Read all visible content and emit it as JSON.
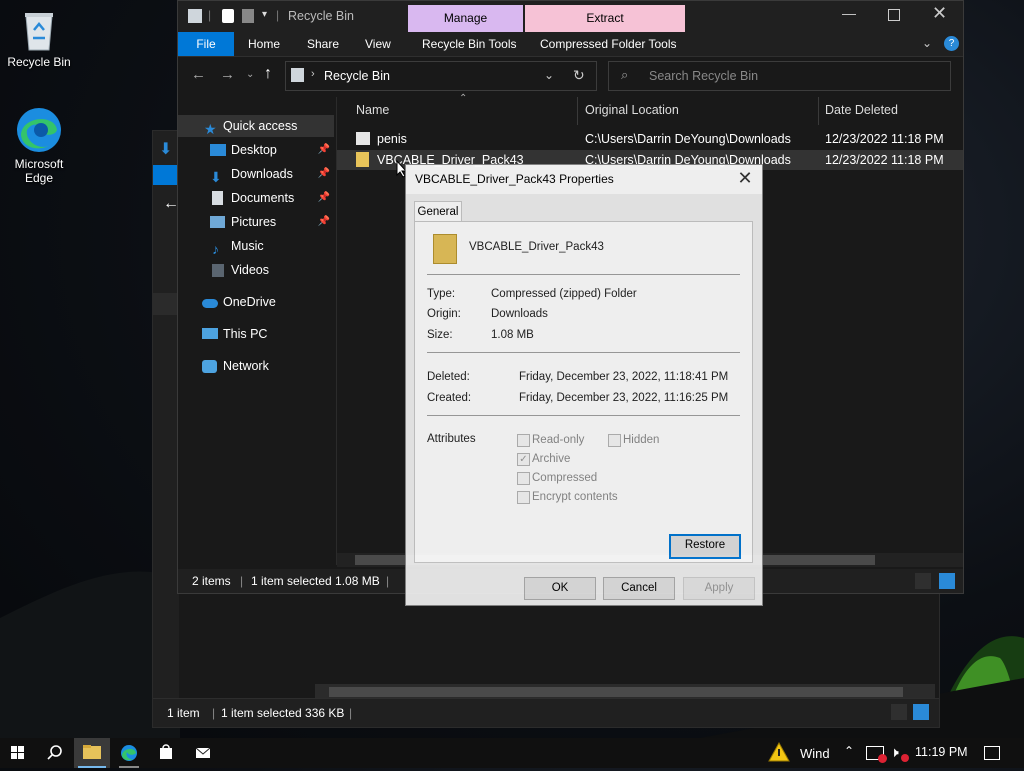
{
  "desktop": {
    "icons": [
      {
        "label": "Recycle Bin"
      },
      {
        "label": "Microsoft Edge"
      }
    ]
  },
  "back_window": {
    "status": {
      "count": "1 item",
      "selected": "1 item selected  336 KB"
    }
  },
  "window": {
    "title": "Recycle Bin",
    "context_tabs": {
      "manage": "Manage",
      "extract": "Extract"
    },
    "ribbon_tabs": [
      "File",
      "Home",
      "Share",
      "View",
      "Recycle Bin Tools",
      "Compressed Folder Tools"
    ],
    "address": {
      "location": "Recycle Bin"
    },
    "search": {
      "placeholder": "Search Recycle Bin"
    },
    "nav": {
      "quick_access": "Quick access",
      "desktop": "Desktop",
      "downloads": "Downloads",
      "documents": "Documents",
      "pictures": "Pictures",
      "music": "Music",
      "videos": "Videos",
      "onedrive": "OneDrive",
      "this_pc": "This PC",
      "network": "Network"
    },
    "columns": {
      "name": "Name",
      "original_location": "Original Location",
      "date_deleted": "Date Deleted"
    },
    "files": [
      {
        "name": "penis",
        "location": "C:\\Users\\Darrin DeYoung\\Downloads",
        "date": "12/23/2022 11:18 PM"
      },
      {
        "name": "VBCABLE_Driver_Pack43",
        "location": "C:\\Users\\Darrin DeYoung\\Downloads",
        "date": "12/23/2022 11:18 PM"
      }
    ],
    "status": {
      "count": "2 items",
      "selected": "1 item selected  1.08 MB"
    }
  },
  "dialog": {
    "title": "VBCABLE_Driver_Pack43 Properties",
    "tab": "General",
    "file_name": "VBCABLE_Driver_Pack43",
    "type_label": "Type:",
    "type_value": "Compressed (zipped) Folder",
    "origin_label": "Origin:",
    "origin_value": "Downloads",
    "size_label": "Size:",
    "size_value": "1.08 MB",
    "deleted_label": "Deleted:",
    "deleted_value": "Friday, December 23, 2022, 11:18:41 PM",
    "created_label": "Created:",
    "created_value": "Friday, December 23, 2022, 11:16:25 PM",
    "attributes_label": "Attributes",
    "attributes": {
      "read_only": {
        "label": "Read-only",
        "checked": false
      },
      "hidden": {
        "label": "Hidden",
        "checked": false
      },
      "archive": {
        "label": "Archive",
        "checked": true
      },
      "compressed": {
        "label": "Compressed",
        "checked": false
      },
      "encrypt": {
        "label": "Encrypt contents",
        "checked": false
      }
    },
    "restore": "Restore",
    "ok": "OK",
    "cancel": "Cancel",
    "apply": "Apply"
  },
  "taskbar": {
    "notification_text": "Wind",
    "time": "11:19 PM"
  }
}
